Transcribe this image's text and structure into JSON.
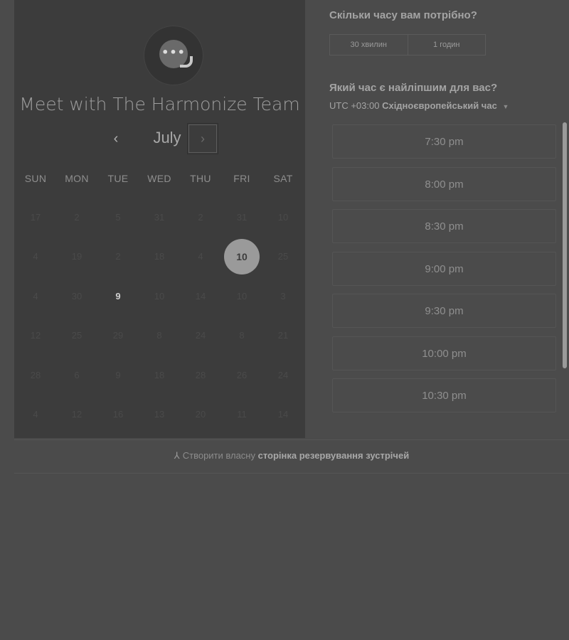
{
  "meeting": {
    "title": "Meet with The Harmonize Team"
  },
  "calendar": {
    "month": "July",
    "prev_label": "‹",
    "next_label": "›",
    "weekdays": [
      "SUN",
      "MON",
      "TUE",
      "WED",
      "THU",
      "FRI",
      "SAT"
    ],
    "weeks": [
      [
        "17",
        "2",
        "5",
        "31",
        "2",
        "31",
        "10"
      ],
      [
        "4",
        "19",
        "2",
        "18",
        "4",
        "10",
        "25"
      ],
      [
        "4",
        "30",
        "9",
        "10",
        "14",
        "10",
        "3"
      ],
      [
        "12",
        "25",
        "29",
        "8",
        "24",
        "8",
        "21"
      ],
      [
        "28",
        "6",
        "9",
        "18",
        "28",
        "26",
        "24"
      ],
      [
        "4",
        "12",
        "16",
        "13",
        "20",
        "11",
        "14"
      ]
    ],
    "selected_day": "10",
    "available_day": "9"
  },
  "duration": {
    "title": "Скільки часу вам потрібно?",
    "options": [
      "30 хвилин",
      "1 годин"
    ]
  },
  "time": {
    "title": "Який час є найліпшим для вас?",
    "timezone_prefix": "UTC +03:00",
    "timezone_name": "Східноєвропейський час",
    "slots": [
      "7:30 pm",
      "8:00 pm",
      "8:30 pm",
      "9:00 pm",
      "9:30 pm",
      "10:00 pm",
      "10:30 pm"
    ]
  },
  "footer": {
    "text": "Створити власну",
    "link": "сторінка резервування зустрічей"
  },
  "colors": {
    "background": "#4b4b4b",
    "panel": "#3c3c3c",
    "selected": "#9a9a9a"
  }
}
